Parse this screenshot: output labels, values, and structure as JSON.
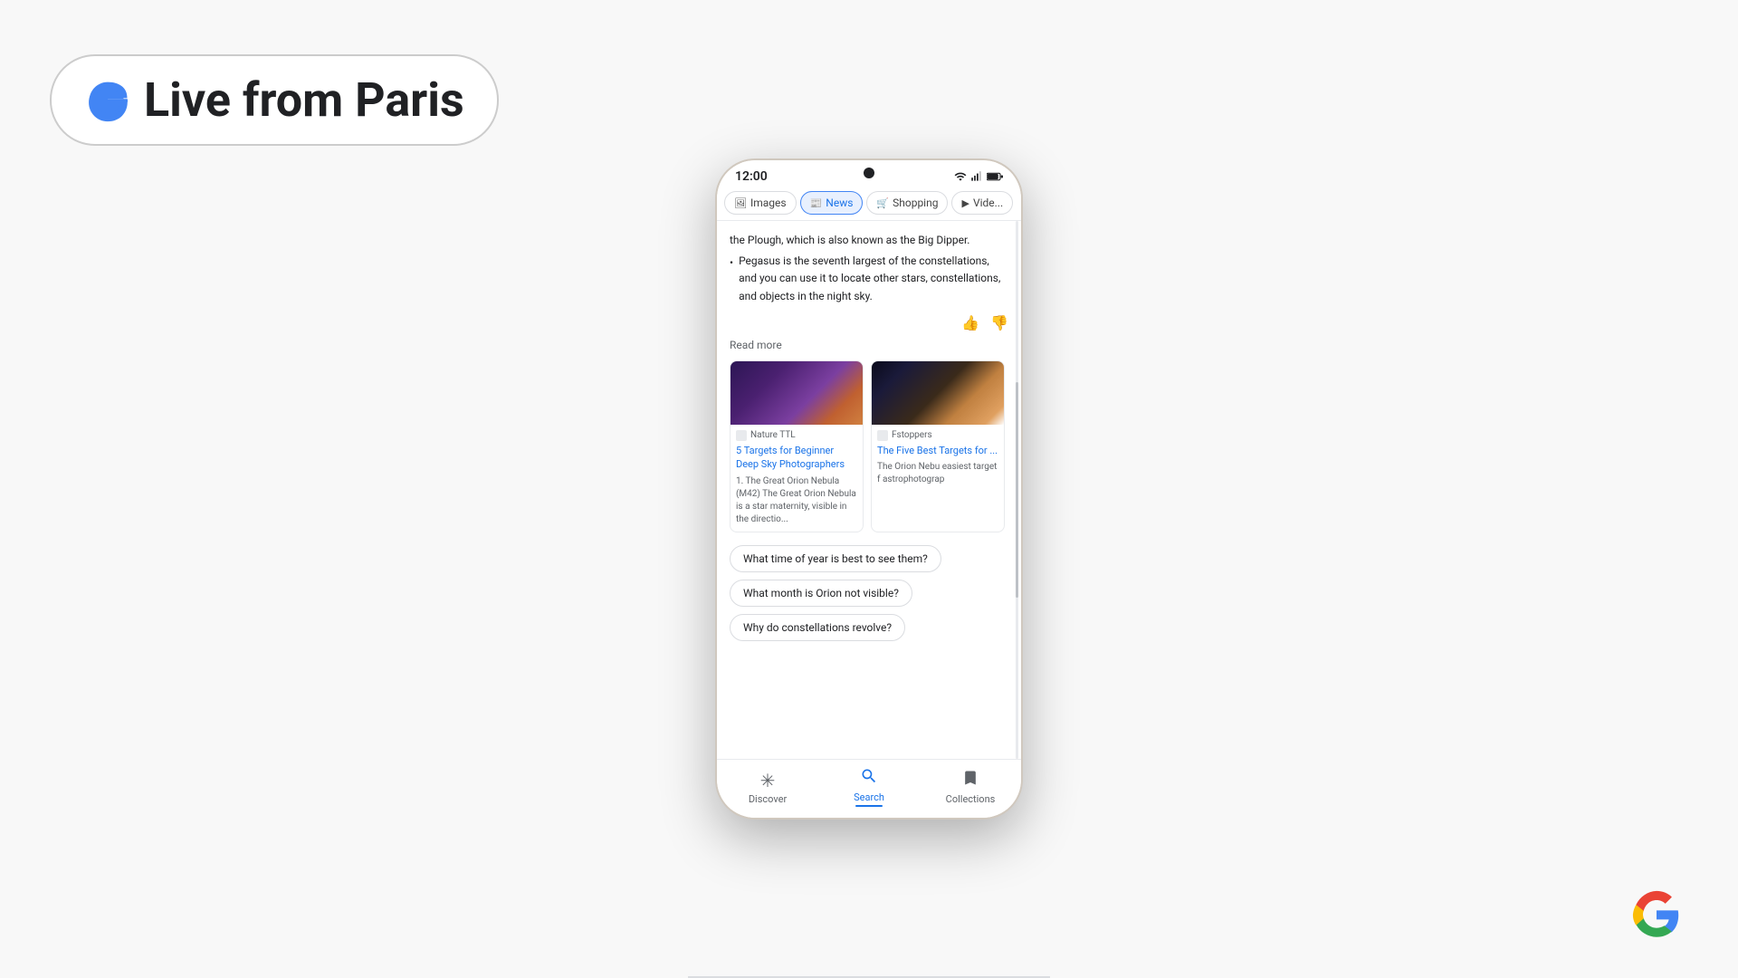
{
  "badge": {
    "text": "Live from Paris"
  },
  "phone": {
    "status_bar": {
      "time": "12:00",
      "signal": "▲▌▌",
      "battery": "🔋"
    },
    "tabs": [
      {
        "label": "Images",
        "icon": "🖼",
        "active": false
      },
      {
        "label": "News",
        "icon": "📰",
        "active": true
      },
      {
        "label": "Shopping",
        "icon": "🛒",
        "active": false
      },
      {
        "label": "Vide...",
        "icon": "▶",
        "active": false
      }
    ],
    "content": {
      "partial_line": "the Plough, which is also known as the Big Dipper.",
      "bullet1": "Pegasus is the seventh largest of the constellations, and you can use it to locate other stars, constellations, and objects in the night sky.",
      "read_more": "Read more",
      "articles": [
        {
          "source": "Nature TTL",
          "title": "5 Targets for Beginner Deep Sky Photographers",
          "snippet": "1. The Great Orion Nebula (M42) The Great Orion Nebula is a star maternity, visible in the directio..."
        },
        {
          "source": "Fstoppers",
          "title": "The Five Best Targets for ...",
          "snippet": "The Orion Nebu easiest target f astrophotograp"
        }
      ],
      "suggestions": [
        "What time of year is best to see them?",
        "What month is Orion not visible?",
        "Why do constellations revolve?"
      ]
    },
    "bottom_nav": [
      {
        "label": "Discover",
        "icon": "✳",
        "active": false
      },
      {
        "label": "Search",
        "icon": "🔍",
        "active": true
      },
      {
        "label": "Collections",
        "icon": "🔖",
        "active": false
      }
    ]
  }
}
